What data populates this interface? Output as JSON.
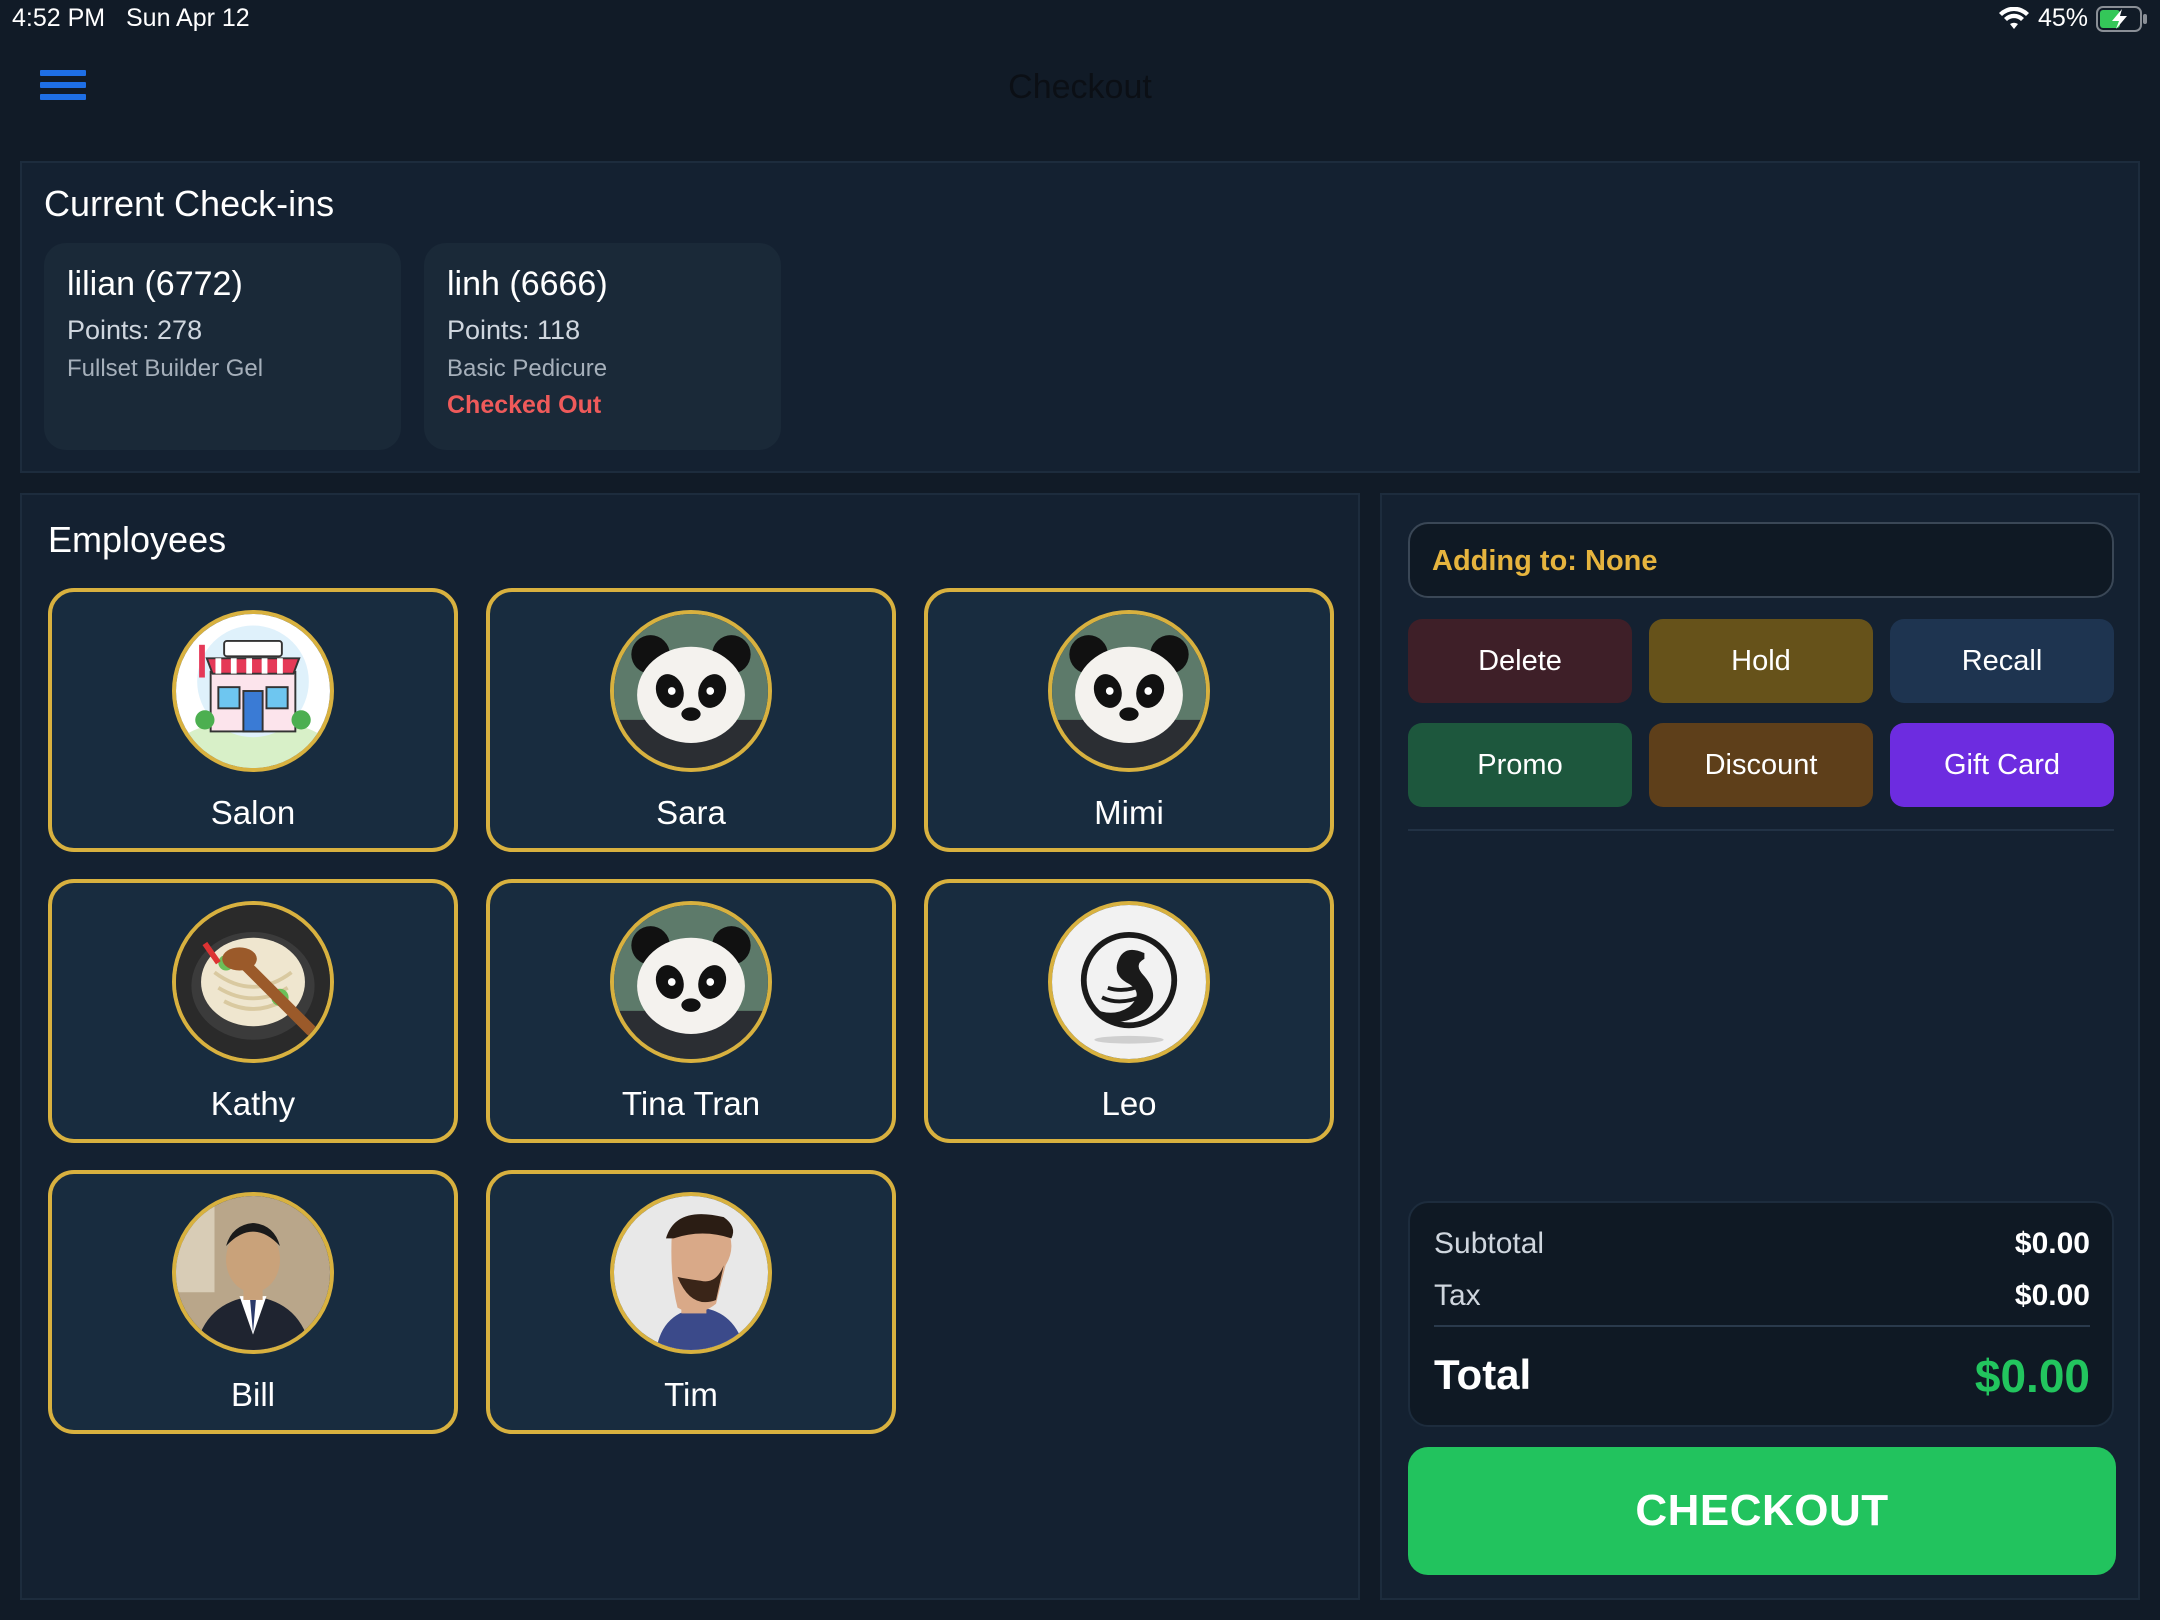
{
  "status_bar": {
    "time": "4:52 PM",
    "date": "Sun Apr 12",
    "battery": "45%",
    "icons": [
      "wifi-icon",
      "battery-charging-icon"
    ]
  },
  "nav": {
    "title": "Checkout",
    "menu_icon": "hamburger-menu-icon",
    "accent_color": "#1e6fe6"
  },
  "checkins": {
    "title": "Current Check-ins",
    "items": [
      {
        "name": "lilian (6772)",
        "points": "Points: 278",
        "service": "Fullset Builder Gel",
        "status": ""
      },
      {
        "name": "linh (6666)",
        "points": "Points: 118",
        "service": "Basic Pedicure",
        "status": "Checked Out"
      }
    ]
  },
  "employees": {
    "title": "Employees",
    "items": [
      {
        "name": "Salon",
        "avatar": "salon-storefront-avatar"
      },
      {
        "name": "Sara",
        "avatar": "panda-avatar"
      },
      {
        "name": "Mimi",
        "avatar": "panda-avatar"
      },
      {
        "name": "Kathy",
        "avatar": "noodle-bowl-avatar"
      },
      {
        "name": "Tina Tran",
        "avatar": "panda-avatar"
      },
      {
        "name": "Leo",
        "avatar": "swan-logo-avatar"
      },
      {
        "name": "Bill",
        "avatar": "man-in-suit-avatar"
      },
      {
        "name": "Tim",
        "avatar": "bearded-man-avatar"
      }
    ]
  },
  "checkout": {
    "adding_to": "Adding to: None",
    "actions": [
      {
        "label": "Delete",
        "color": "#3e1f28"
      },
      {
        "label": "Hold",
        "color": "#66521a"
      },
      {
        "label": "Recall",
        "color": "#1e3450"
      },
      {
        "label": "Promo",
        "color": "#1d573d"
      },
      {
        "label": "Discount",
        "color": "#5e3f1a"
      },
      {
        "label": "Gift Card",
        "color": "#6d2ce0"
      }
    ],
    "subtotal_label": "Subtotal",
    "subtotal_value": "$0.00",
    "tax_label": "Tax",
    "tax_value": "$0.00",
    "total_label": "Total",
    "total_value": "$0.00",
    "total_color": "#22c55e",
    "checkout_label": "CHECKOUT",
    "checkout_color": "#22c35e"
  }
}
